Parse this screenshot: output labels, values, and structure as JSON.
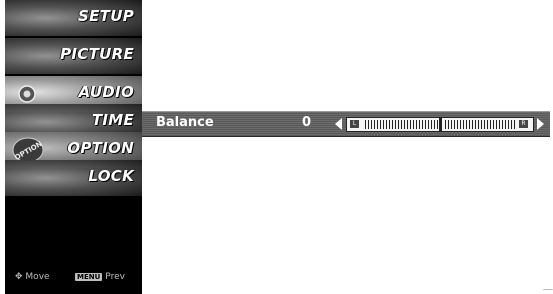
{
  "menu": {
    "items": [
      {
        "label": "SETUP",
        "icon": "setup-icon",
        "active": false
      },
      {
        "label": "PICTURE",
        "icon": "picture-icon",
        "active": false
      },
      {
        "label": "AUDIO",
        "icon": "audio-icon",
        "active": true
      },
      {
        "label": "TIME",
        "icon": "time-icon",
        "active": false
      },
      {
        "label": "OPTION",
        "icon": "option-icon",
        "active": false
      },
      {
        "label": "LOCK",
        "icon": "lock-icon",
        "active": false
      }
    ],
    "option_icon_text": "OPTION"
  },
  "hints": {
    "move_label": "Move",
    "menu_key": "MENU",
    "prev_label": "Prev"
  },
  "balance": {
    "label": "Balance",
    "value": "0",
    "left_end": "L",
    "right_end": "R",
    "position": 0.5
  },
  "colors": {
    "panel_bg": "#000000",
    "bar_bg": "#606060",
    "text": "#ffffff"
  }
}
